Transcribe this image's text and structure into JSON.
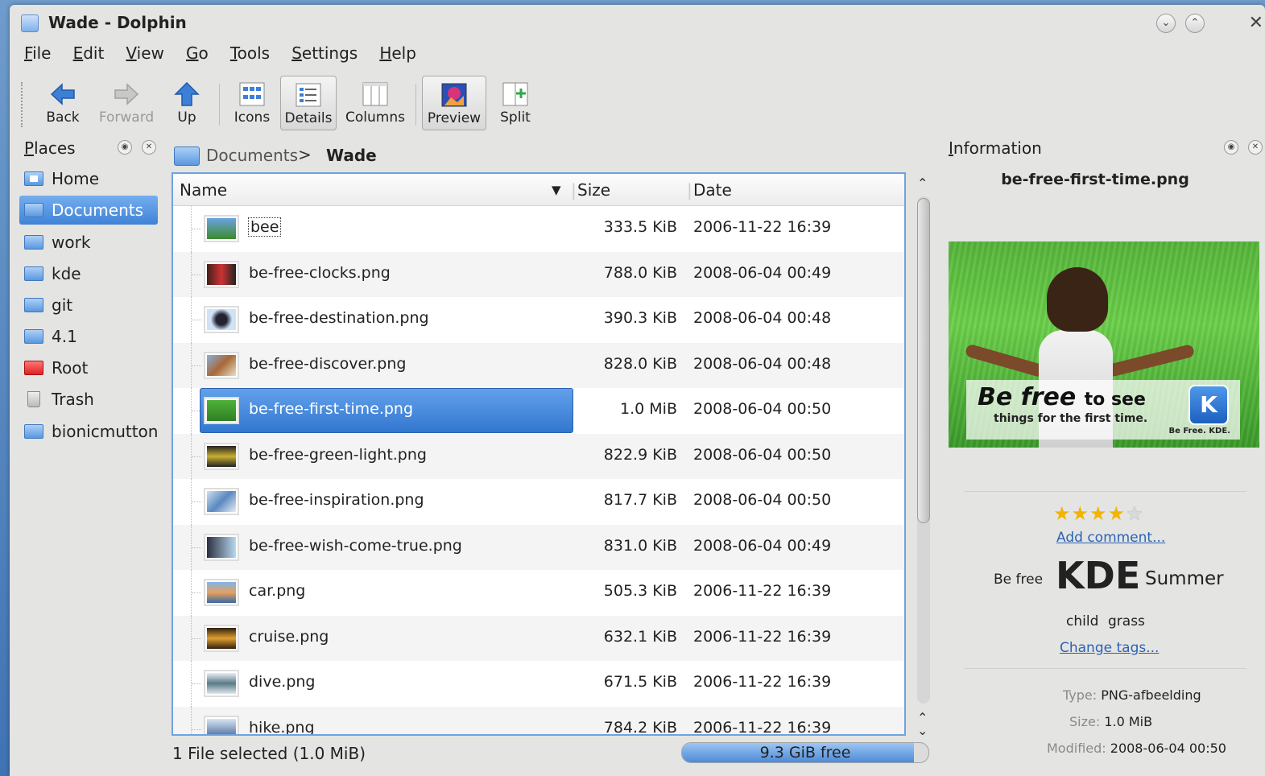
{
  "window": {
    "title": "Wade - Dolphin"
  },
  "menu": [
    "File",
    "Edit",
    "View",
    "Go",
    "Tools",
    "Settings",
    "Help"
  ],
  "toolbar": {
    "back": "Back",
    "forward": "Forward",
    "up": "Up",
    "icons": "Icons",
    "details": "Details",
    "columns": "Columns",
    "preview": "Preview",
    "split": "Split"
  },
  "places": {
    "title": "Places",
    "items": [
      "Home",
      "Documents",
      "work",
      "kde",
      "git",
      "4.1",
      "Root",
      "Trash",
      "bionicmutton"
    ],
    "selected": "Documents"
  },
  "breadcrumb": {
    "parent": "Documents",
    "sep": ">",
    "current": "Wade"
  },
  "files": {
    "columns": {
      "name": "Name",
      "size": "Size",
      "date": "Date"
    },
    "rows": [
      {
        "name": "bee",
        "size": "333.5 KiB",
        "date": "2006-11-22 16:39"
      },
      {
        "name": "be-free-clocks.png",
        "size": "788.0 KiB",
        "date": "2008-06-04 00:49"
      },
      {
        "name": "be-free-destination.png",
        "size": "390.3 KiB",
        "date": "2008-06-04 00:48"
      },
      {
        "name": "be-free-discover.png",
        "size": "828.0 KiB",
        "date": "2008-06-04 00:48"
      },
      {
        "name": "be-free-first-time.png",
        "size": "1.0 MiB",
        "date": "2008-06-04 00:50"
      },
      {
        "name": "be-free-green-light.png",
        "size": "822.9 KiB",
        "date": "2008-06-04 00:50"
      },
      {
        "name": "be-free-inspiration.png",
        "size": "817.7 KiB",
        "date": "2008-06-04 00:50"
      },
      {
        "name": "be-free-wish-come-true.png",
        "size": "831.0 KiB",
        "date": "2008-06-04 00:49"
      },
      {
        "name": "car.png",
        "size": "505.3 KiB",
        "date": "2006-11-22 16:39"
      },
      {
        "name": "cruise.png",
        "size": "632.1 KiB",
        "date": "2006-11-22 16:39"
      },
      {
        "name": "dive.png",
        "size": "671.5 KiB",
        "date": "2006-11-22 16:39"
      },
      {
        "name": "hike.png",
        "size": "784.2 KiB",
        "date": "2006-11-22 16:39"
      }
    ],
    "selected_index": 4
  },
  "status": {
    "text": "1 File selected (1.0 MiB)",
    "free": "9.3 GiB free",
    "used_fraction": 0.94
  },
  "info": {
    "title": "Information",
    "filename": "be-free-first-time.png",
    "preview": {
      "headline": "Be free",
      "headline_rest": "to see",
      "subline": "things for the first time.",
      "logo": "K",
      "tagline": "Be Free.  KDE."
    },
    "rating": 4,
    "rating_max": 5,
    "add_comment": "Add comment...",
    "tags": [
      "Be free",
      "KDE",
      "Summer",
      "child",
      "grass"
    ],
    "change_tags": "Change tags...",
    "meta": [
      {
        "key": "Type:",
        "value": "PNG-afbeelding"
      },
      {
        "key": "Size:",
        "value": "1.0 MiB"
      },
      {
        "key": "Modified:",
        "value": "2008-06-04 00:50"
      }
    ]
  },
  "colors": {
    "accent": "#3f82d6",
    "selection": "#3277d0",
    "link": "#2c62b6",
    "star": "#f1b400"
  }
}
